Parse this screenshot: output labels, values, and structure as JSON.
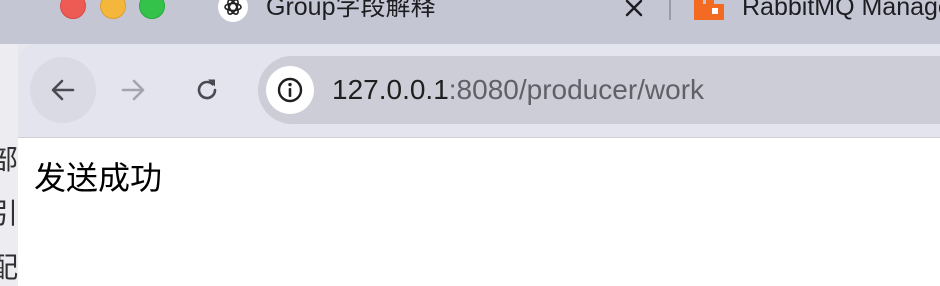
{
  "tabs": [
    {
      "title": "Group字段解释",
      "favicon": "openai-icon"
    },
    {
      "title": "RabbitMQ Manage",
      "favicon": "rabbitmq-icon"
    }
  ],
  "background_window": {
    "fragments": [
      "部",
      "引",
      "配"
    ]
  },
  "address_bar": {
    "url_host": "127.0.0.1",
    "url_rest": ":8080/producer/work"
  },
  "page": {
    "message": "发送成功"
  },
  "colors": {
    "tabstrip_bg": "#c5c6d4",
    "toolbar_bg": "#e3e4ee",
    "omnibox_bg": "#cccdd7"
  }
}
